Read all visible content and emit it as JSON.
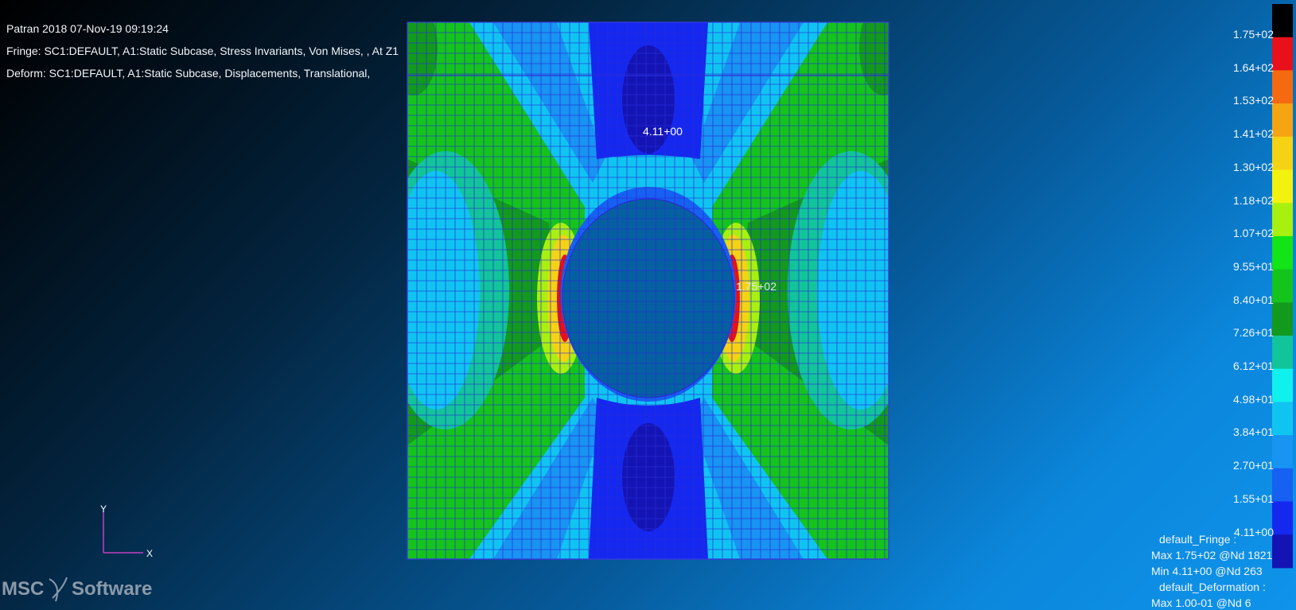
{
  "header": {
    "title": "Patran 2018 07-Nov-19 09:19:24",
    "fringe": "Fringe: SC1:DEFAULT, A1:Static Subcase, Stress Invariants, Von Mises, , At Z1",
    "deform": "Deform: SC1:DEFAULT, A1:Static Subcase, Displacements, Translational,"
  },
  "plot": {
    "min_marker_label": "4.11+00",
    "max_marker_label": "1.75+02"
  },
  "legend": {
    "labels": [
      "1.75+02",
      "1.64+02",
      "1.53+02",
      "1.41+02",
      "1.30+02",
      "1.18+02",
      "1.07+02",
      "9.55+01",
      "8.40+01",
      "7.26+01",
      "6.12+01",
      "4.98+01",
      "3.84+01",
      "2.70+01",
      "1.55+01",
      "4.11+00"
    ],
    "colors": [
      "#000000",
      "#e8101a",
      "#f56a10",
      "#f5a412",
      "#f5d314",
      "#f2f20e",
      "#a8f010",
      "#12e418",
      "#14c41c",
      "#129a1c",
      "#12c49a",
      "#10f0ec",
      "#10c4f2",
      "#1894f2",
      "#1660f2",
      "#1428f0",
      "#1414b4"
    ]
  },
  "summary": {
    "fringe_name": "default_Fringe :",
    "max": "Max 1.75+02 @Nd 1821",
    "min": "Min 4.11+00 @Nd 263",
    "deform_name": "default_Deformation :",
    "deform_max": "Max 1.00-01 @Nd 6"
  },
  "triad": {
    "y": "Y",
    "x": "X"
  },
  "logo": {
    "text1": "MSC",
    "text2": "Software"
  }
}
